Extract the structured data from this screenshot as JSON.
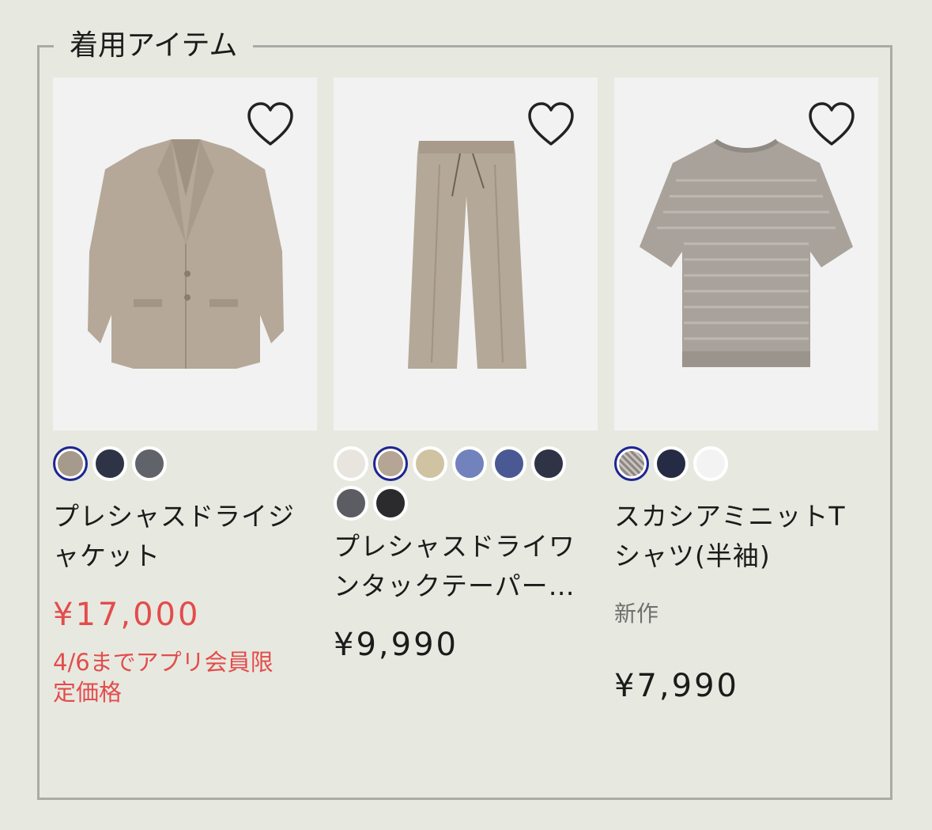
{
  "section": {
    "title": "着用アイテム"
  },
  "products": [
    {
      "name_line1": "プレシャスドライジ",
      "name_line2": "ャケット",
      "price": "¥17,000",
      "promo_line1": "4/6までアプリ会員限",
      "promo_line2": "定価格",
      "swatches": [
        "#a59a8c",
        "#2e3345",
        "#60646a"
      ],
      "selected_swatch": 0
    },
    {
      "name_line1": "プレシャスドライワ",
      "name_line2": "ンタックテーパー…",
      "price": "¥9,990",
      "swatches": [
        "#e8e5df",
        "#b4a594",
        "#cfc3a2",
        "#7182bd",
        "#4a5994",
        "#2e3345",
        "#5b5d63",
        "#2b2b2d"
      ],
      "selected_swatch": 1
    },
    {
      "name_line1": "スカシアミニットT",
      "name_line2": "シャツ(半袖)",
      "badge": "新作",
      "price": "¥7,990",
      "swatches": [
        "#9a9590",
        "#252b44",
        "#f3f3f3"
      ],
      "selected_swatch": 0
    }
  ],
  "icons": {
    "favorite": "heart-outline-icon"
  },
  "colors": {
    "accent_sale": "#e34c4c",
    "selected_ring": "#1e2592",
    "frame": "#a9aca6"
  }
}
